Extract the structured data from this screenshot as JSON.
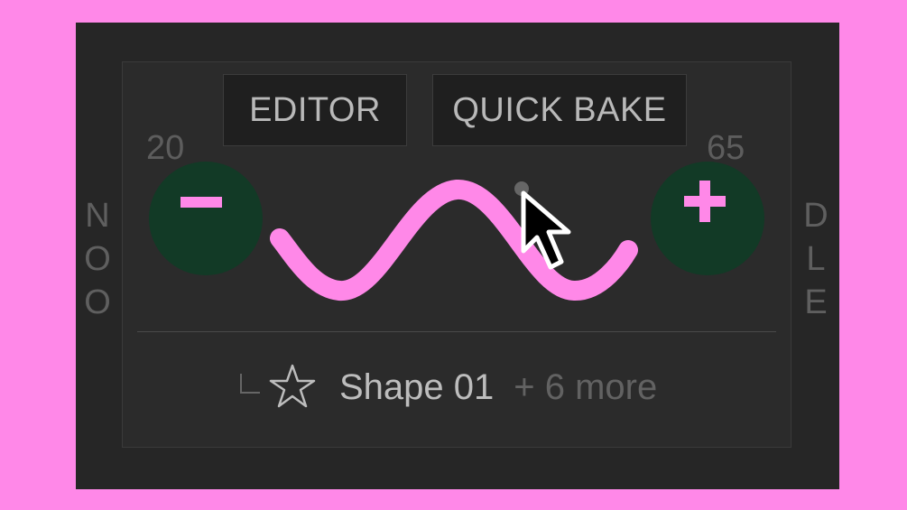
{
  "side_labels": {
    "left": "N\nO\nO",
    "right": "D\nL\nE"
  },
  "numbers": {
    "left": "20",
    "right": "65"
  },
  "buttons": {
    "editor": "EDITOR",
    "quick_bake": "QUICK BAKE"
  },
  "footer": {
    "shape_name": "Shape 01",
    "more": "+ 6 more"
  },
  "icons": {
    "minus": "minus-icon",
    "plus": "plus-icon",
    "star": "star-icon",
    "tree": "tree-branch-icon",
    "cursor": "mouse-cursor-icon"
  },
  "colors": {
    "background": "#ff88e8",
    "accent": "#ff88e8",
    "button_circle": "#123a26",
    "panel": "#2b2b2b"
  }
}
